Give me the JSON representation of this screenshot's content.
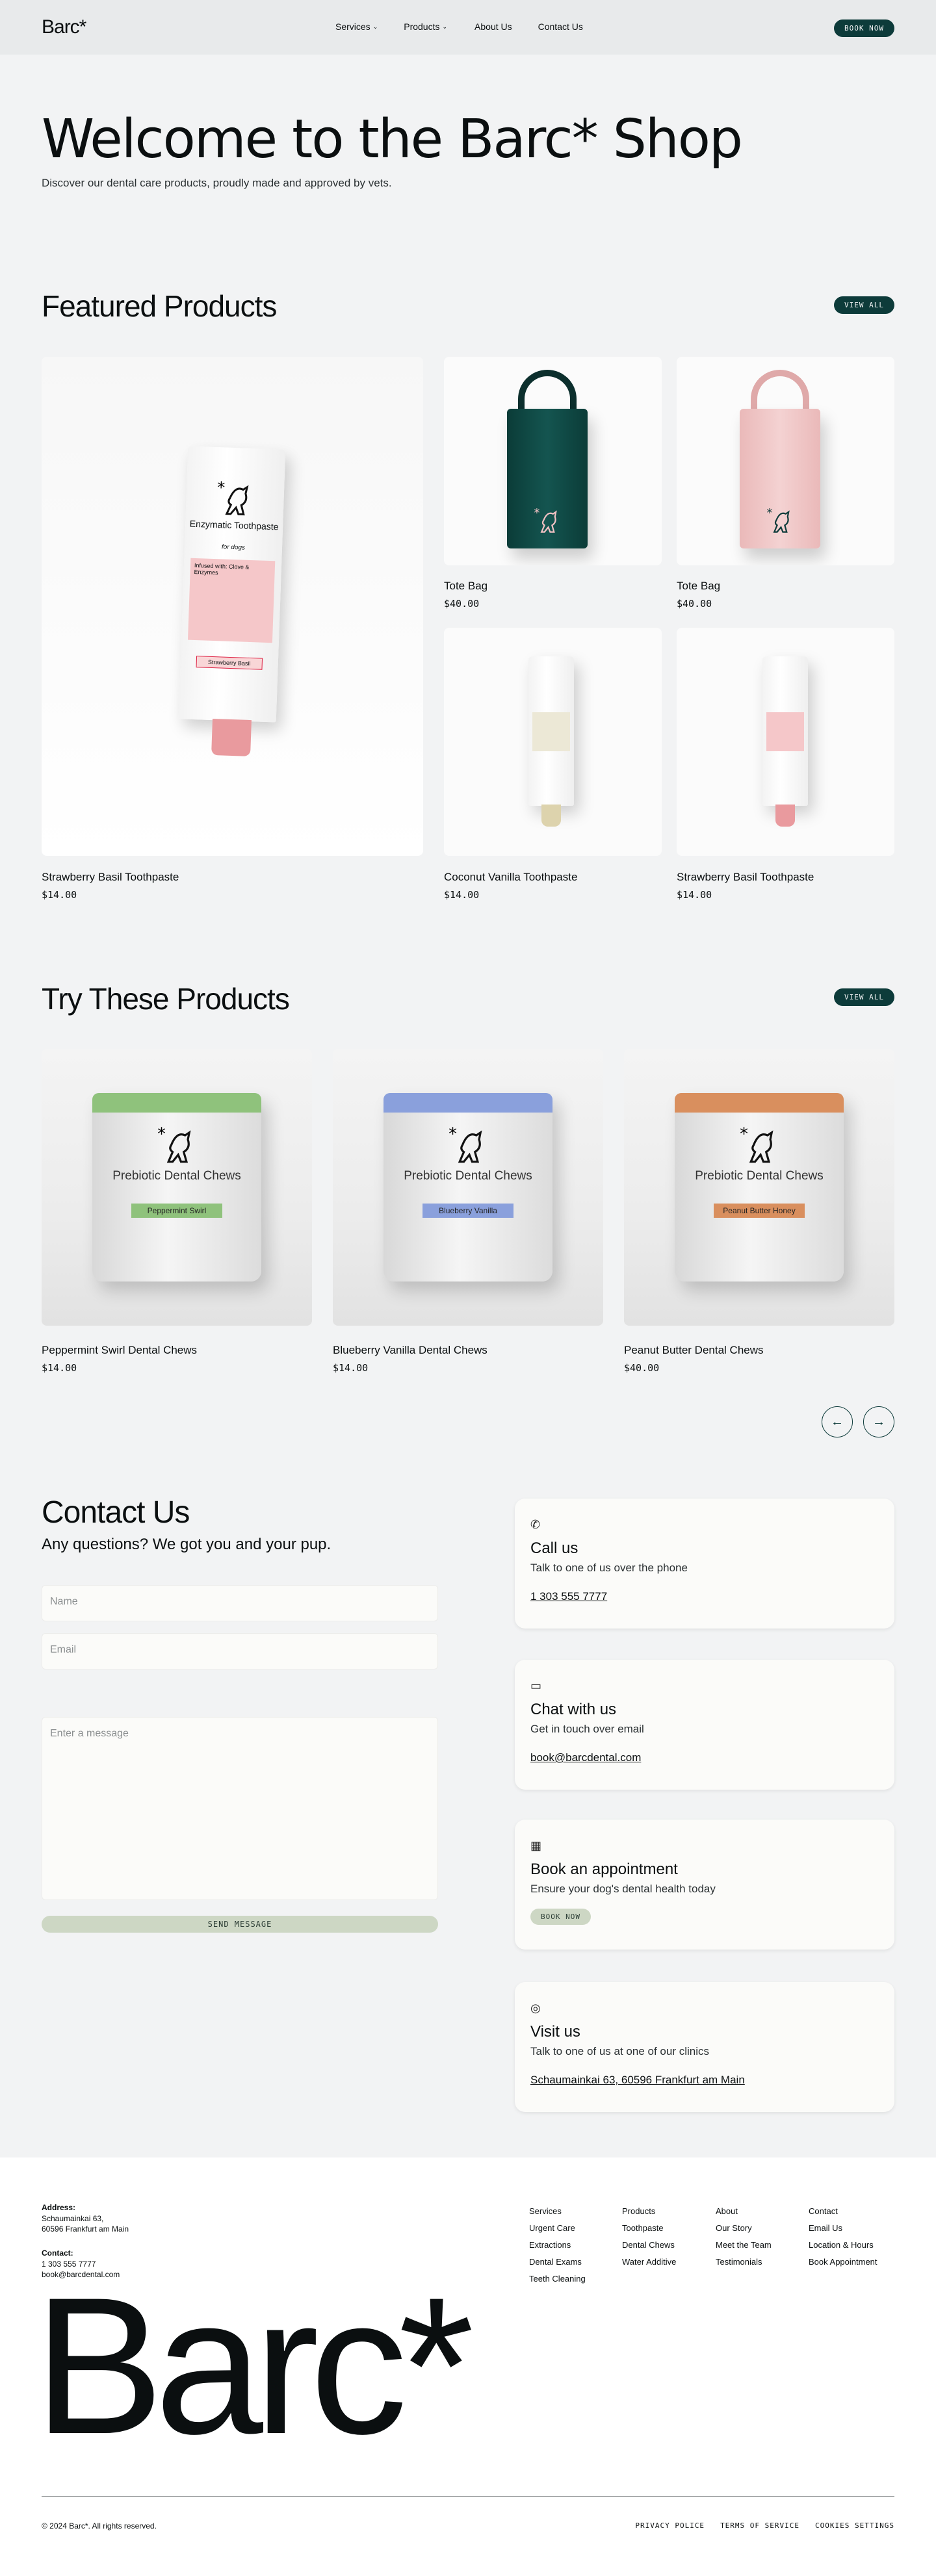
{
  "nav": {
    "logo": "Barc*",
    "links": [
      {
        "label": "Services",
        "has_dropdown": true
      },
      {
        "label": "Products",
        "has_dropdown": true
      },
      {
        "label": "About Us",
        "has_dropdown": false
      },
      {
        "label": "Contact Us",
        "has_dropdown": false
      }
    ],
    "cta": "BOOK NOW"
  },
  "hero": {
    "title": "Welcome to the Barc* Shop",
    "subtitle": "Discover our dental care products, proudly made and approved by vets."
  },
  "featured": {
    "title": "Featured Products",
    "view_all": "VIEW ALL",
    "products": [
      {
        "name": "Strawberry Basil Toothpaste",
        "price": "$14.00"
      },
      {
        "name": "Tote Bag",
        "price": "$40.00"
      },
      {
        "name": "Tote Bag",
        "price": "$40.00"
      },
      {
        "name": "Coconut Vanilla Toothpaste",
        "price": "$14.00"
      },
      {
        "name": "Strawberry Basil Toothpaste",
        "price": "$14.00"
      }
    ],
    "tube_text": {
      "brand": "Enzymatic Toothpaste",
      "for": "for dogs",
      "infused": "Infused with: Clove & Enzymes",
      "flavor": "Strawberry Basil"
    }
  },
  "try": {
    "title": "Try These Products",
    "view_all": "VIEW ALL",
    "products": [
      {
        "name": "Peppermint Swirl Dental Chews",
        "price": "$14.00",
        "label": "Peppermint Swirl",
        "accent": "#8fc27c"
      },
      {
        "name": "Blueberry Vanilla Dental Chews",
        "price": "$14.00",
        "label": "Blueberry Vanilla",
        "accent": "#8aa0dc"
      },
      {
        "name": "Peanut Butter Dental Chews",
        "price": "$40.00",
        "label": "Peanut Butter Honey",
        "accent": "#d98f5e"
      }
    ],
    "pouch_title": "Prebiotic Dental Chews"
  },
  "contact": {
    "title": "Contact Us",
    "subtitle": "Any questions? We got you and your pup.",
    "name_placeholder": "Name",
    "email_placeholder": "Email",
    "message_placeholder": "Enter a message",
    "send": "SEND MESSAGE",
    "cards": [
      {
        "icon": "phone-icon",
        "title": "Call us",
        "desc": "Talk to one of us over the phone",
        "link": "1 303 555 7777"
      },
      {
        "icon": "chat-icon",
        "title": "Chat with us",
        "desc": "Get in touch over email",
        "link": "book@barcdental.com"
      },
      {
        "icon": "calendar-icon",
        "title": "Book an appointment",
        "desc": "Ensure your dog's dental health today",
        "button": "BOOK NOW"
      },
      {
        "icon": "compass-icon",
        "title": "Visit us",
        "desc": "Talk to one of us at one of our clinics",
        "link": "Schaumainkai 63, 60596 Frankfurt am Main"
      }
    ]
  },
  "footer": {
    "address_label": "Address:",
    "address_line1": "Schaumainkai 63,",
    "address_line2": "60596 Frankfurt am Main",
    "contact_label": "Contact:",
    "contact_phone": "1 303 555 7777",
    "contact_email": "book@barcdental.com",
    "columns": [
      {
        "items": [
          "Services",
          "Urgent Care",
          "Extractions",
          "Dental Exams",
          "Teeth Cleaning"
        ]
      },
      {
        "items": [
          "Products",
          "Toothpaste",
          "Dental Chews",
          "Water Additive"
        ]
      },
      {
        "items": [
          "About",
          "Our Story",
          "Meet the Team",
          "Testimonials"
        ]
      },
      {
        "items": [
          "Contact",
          "Email Us",
          "Location & Hours",
          "Book Appointment"
        ]
      }
    ],
    "brand": "Barc*",
    "copyright": "© 2024 Barc*. All rights reserved.",
    "legal": [
      "PRIVACY POLICE",
      "TERMS OF SERVICE",
      "COOKIES SETTINGS"
    ]
  },
  "colors": {
    "brand_dark": "#0d3b3a",
    "tote_green": "#0f4a45",
    "tote_pink": "#efc6c6",
    "muted_green": "#cdd7c4"
  }
}
